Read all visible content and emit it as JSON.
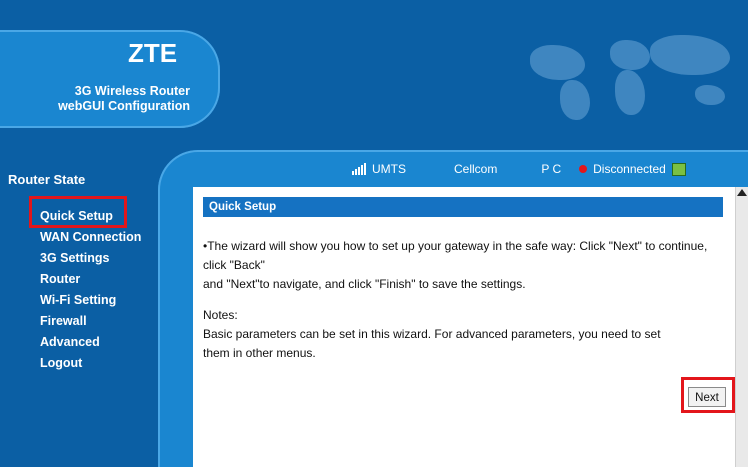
{
  "header": {
    "brand": "ZTE",
    "subtitle_line1": "3G Wireless Router",
    "subtitle_line2": "webGUI Configuration"
  },
  "sidebar": {
    "section_title": "Router State",
    "items": [
      {
        "label": "Quick Setup"
      },
      {
        "label": "WAN Connection"
      },
      {
        "label": "3G Settings"
      },
      {
        "label": "Router"
      },
      {
        "label": "Wi-Fi Setting"
      },
      {
        "label": "Firewall"
      },
      {
        "label": "Advanced"
      },
      {
        "label": "Logout"
      }
    ]
  },
  "status": {
    "network": "UMTS",
    "operator": "Cellcom",
    "mode": "P C",
    "connection": "Disconnected"
  },
  "content": {
    "panel_title": "Quick Setup",
    "paragraph1": "•The wizard will show you how to set up your gateway in the safe way: Click \"Next\" to continue, click \"Back\"",
    "paragraph1_cont": "and \"Next\"to navigate, and click \"Finish\" to save the settings.",
    "notes_label": "Notes:",
    "notes_text1": "Basic parameters can be set in this wizard. For advanced parameters, you need to set",
    "notes_text2": "them in other menus.",
    "next_label": "Next"
  },
  "colors": {
    "background": "#0b5fa4",
    "panel": "#1a86d0",
    "title_bar": "#1572c2",
    "highlight": "#e3161b"
  }
}
